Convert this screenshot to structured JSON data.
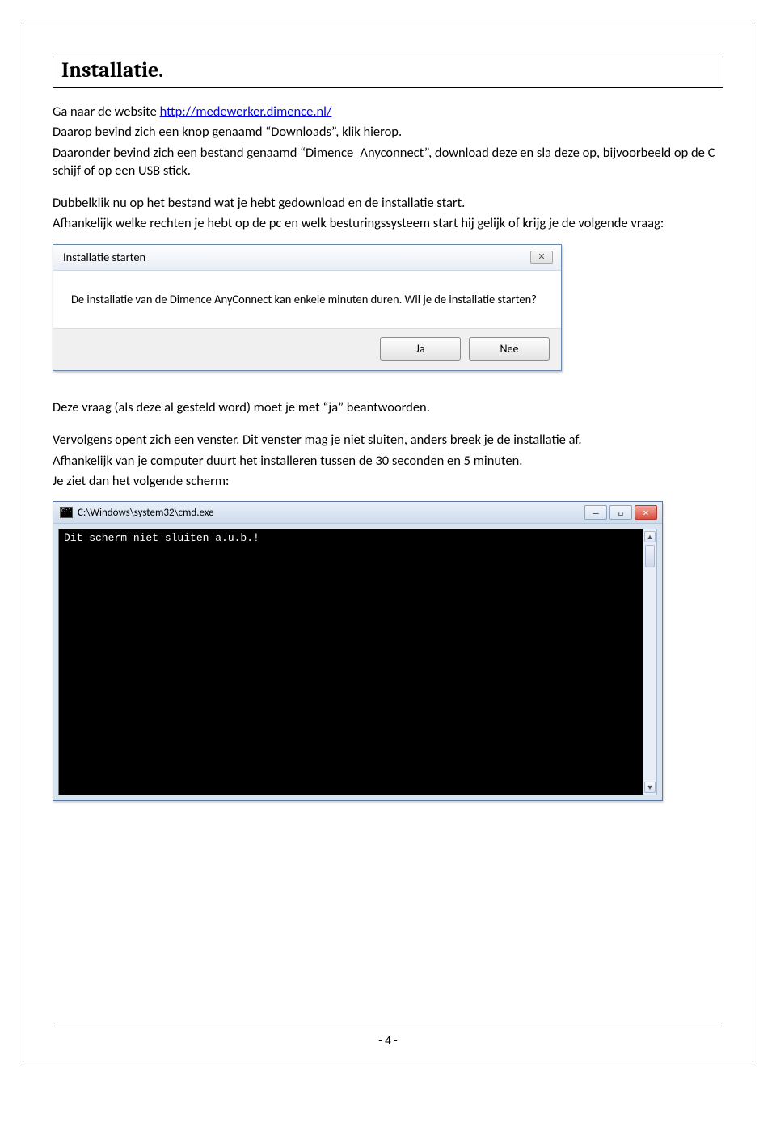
{
  "heading": "Installatie.",
  "p1_prefix": "Ga naar de website ",
  "p1_link": "http://medewerker.dimence.nl/",
  "p2": "Daarop bevind zich een knop genaamd “Downloads”, klik hierop.",
  "p3": "Daaronder bevind zich een bestand genaamd “Dimence_Anyconnect”, download deze en sla deze op, bijvoorbeeld op de C schijf of op een USB stick.",
  "p4": "Dubbelklik nu op het bestand wat je hebt gedownload en de installatie start.",
  "p5": "Afhankelijk welke rechten je hebt op de pc en welk besturingssysteem start hij gelijk of krijg je de volgende vraag:",
  "dialog": {
    "title": "Installatie starten",
    "close_glyph": "✕",
    "body": "De installatie van de Dimence AnyConnect kan enkele minuten duren. Wil je de installatie starten?",
    "ja": "Ja",
    "nee": "Nee"
  },
  "p6": "Deze vraag (als deze al gesteld word) moet je met “ja” beantwoorden.",
  "p7_a": "Vervolgens opent zich een venster. Dit venster mag je ",
  "p7_niet": "niet",
  "p7_b": " sluiten, anders breek je de installatie af.",
  "p8": "Afhankelijk van je computer duurt het installeren tussen de 30 seconden en 5 minuten.",
  "p9": "Je ziet dan het volgende scherm:",
  "cmd": {
    "path": "C:\\Windows\\system32\\cmd.exe",
    "text": "Dit scherm niet sluiten a.u.b.!",
    "min": "—",
    "max": "□",
    "close": "✕",
    "up": "▲",
    "down": "▼"
  },
  "page_number": "- 4 -"
}
